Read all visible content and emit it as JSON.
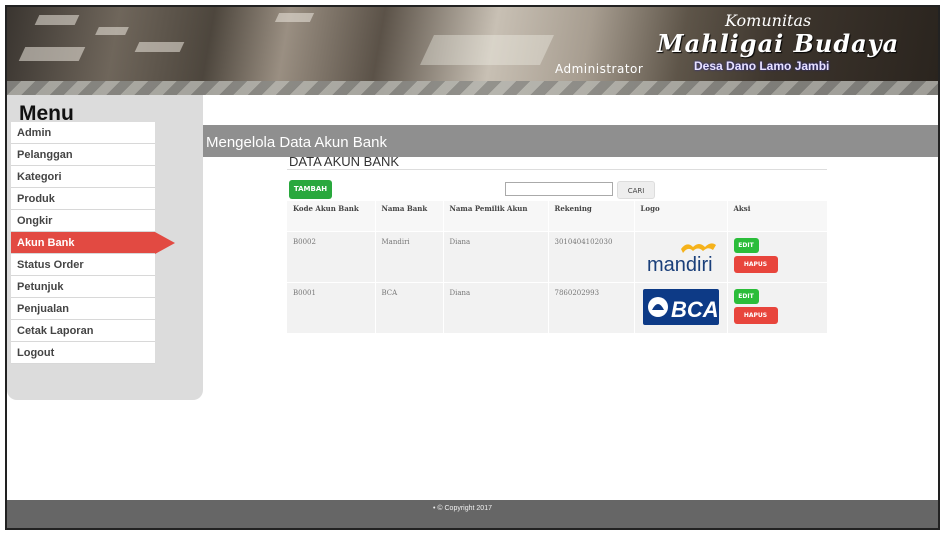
{
  "header": {
    "admin_label": "Administrator",
    "brand_line1": "Komunitas",
    "brand_line2": "Mahligai Budaya",
    "brand_line3": "Desa Dano Lamo Jambi"
  },
  "sidebar": {
    "title": "Menu",
    "items": [
      {
        "label": "Admin"
      },
      {
        "label": "Pelanggan"
      },
      {
        "label": "Kategori"
      },
      {
        "label": "Produk"
      },
      {
        "label": "Ongkir"
      },
      {
        "label": "Akun Bank",
        "active": true
      },
      {
        "label": "Status Order"
      },
      {
        "label": "Petunjuk"
      },
      {
        "label": "Penjualan"
      },
      {
        "label": "Cetak Laporan"
      },
      {
        "label": "Logout"
      }
    ]
  },
  "main": {
    "page_title": "Mengelola Data Akun Bank",
    "section_title": "DATA AKUN BANK",
    "add_button": "TAMBAH",
    "search_value": "",
    "search_button": "CARI",
    "table": {
      "headers": [
        "Kode Akun Bank",
        "Nama Bank",
        "Nama Pemilik Akun",
        "Rekening",
        "Logo",
        "Aksi"
      ],
      "rows": [
        {
          "kode": "B0002",
          "bank": "Mandiri",
          "pemilik": "Diana",
          "rekening": "3010404102030",
          "logo_text": "mandiri",
          "logo_icon": "mandiri-logo-icon",
          "edit": "EDIT",
          "hapus": "HAPUS"
        },
        {
          "kode": "B0001",
          "bank": "BCA",
          "pemilik": "Diana",
          "rekening": "7860202993",
          "logo_text": "BCA",
          "logo_icon": "bca-logo-icon",
          "edit": "EDIT",
          "hapus": "HAPUS"
        }
      ]
    }
  },
  "footer": {
    "text": "• © Copyright 2017"
  },
  "colors": {
    "active_menu": "#e24a42",
    "add_button": "#29a83d",
    "edit_button": "#2bbd3a",
    "delete_button": "#e8453c",
    "title_bar": "#8f8f8f",
    "footer": "#666666"
  }
}
